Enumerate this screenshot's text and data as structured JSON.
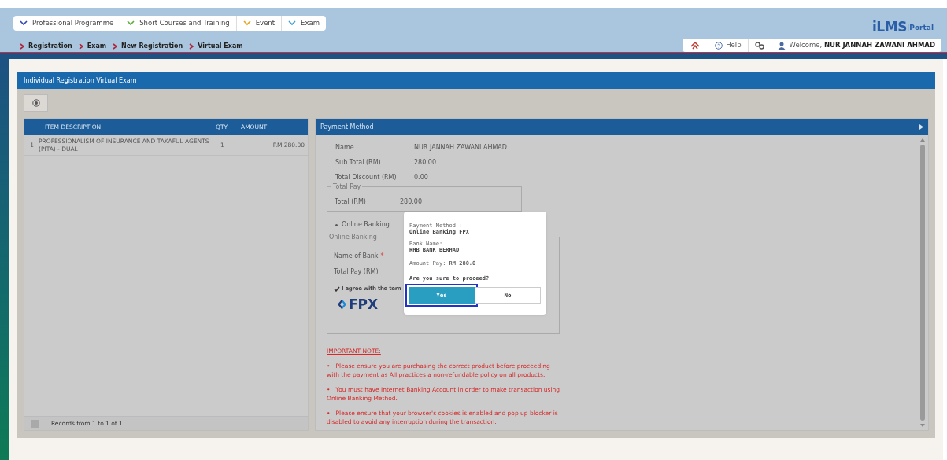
{
  "menu": [
    {
      "label": "Professional Programme",
      "color": "#3346b0"
    },
    {
      "label": "Short Courses and Training",
      "color": "#5aae3c"
    },
    {
      "label": "Event",
      "color": "#e8a21a"
    },
    {
      "label": "Exam",
      "color": "#3aa0d8"
    }
  ],
  "breadcrumb": [
    "Registration",
    "Exam",
    "New Registration",
    "Virtual Exam"
  ],
  "logo": {
    "main": "iLMS",
    "suffix": "|Portal"
  },
  "toolbar": {
    "help": "Help",
    "welcome": "Welcome,",
    "user": "NUR JANNAH ZAWANI AHMAD"
  },
  "panel_title": "Individual Registration Virtual Exam",
  "items_table": {
    "columns": [
      "ITEM DESCRIPTION",
      "QTY",
      "AMOUNT"
    ],
    "rows": [
      {
        "no": "1",
        "description": "PROFESSIONALISM OF INSURANCE AND TAKAFUL AGENTS (PITA) - DUAL",
        "qty": "1",
        "amount": "RM 280.00"
      }
    ],
    "records": "Records from 1 to 1 of 1"
  },
  "payment": {
    "title": "Payment Method",
    "fields": [
      {
        "label": "Name",
        "value": "NUR JANNAH ZAWANI AHMAD"
      },
      {
        "label": "Sub Total (RM)",
        "value": "280.00"
      },
      {
        "label": "Total Discount (RM)",
        "value": "0.00"
      }
    ],
    "total_pay": {
      "legend": "Total Pay",
      "label": "Total (RM)",
      "value": "280.00"
    },
    "method": {
      "label": "Online Banking",
      "selected": true
    },
    "online_banking": {
      "legend": "Online Banking",
      "bank_label": "Name of Bank",
      "required": "*",
      "total_label": "Total Pay (RM)"
    },
    "agree": {
      "label": "I agree with the tern",
      "checked": true
    },
    "fpx": "FPX",
    "note": {
      "title": "IMPORTANT NOTE:",
      "bullets": [
        "•   Please ensure you are purchasing the correct product before proceeding with the payment as AII practices a non-refundable policy on all products.",
        "•   You must have Internet Banking Account in order to make transaction using Online Banking Method.",
        "•   Please ensure that your browser's cookies is enabled and pop up blocker is disabled to avoid any interruption during the transaction."
      ]
    }
  },
  "dialog": {
    "method_label": "Payment Method :",
    "method": "Online Banking FPX",
    "bank_label": "Bank Name:",
    "bank": "RHB BANK BERHAD",
    "amount": "Amount Pay: **RM 280.0**",
    "question": "Are you sure to proceed?",
    "buttons": [
      {
        "label": "Yes",
        "kind": "primary",
        "selected": true
      },
      {
        "label": "No",
        "kind": "secondary",
        "selected": false
      }
    ]
  }
}
